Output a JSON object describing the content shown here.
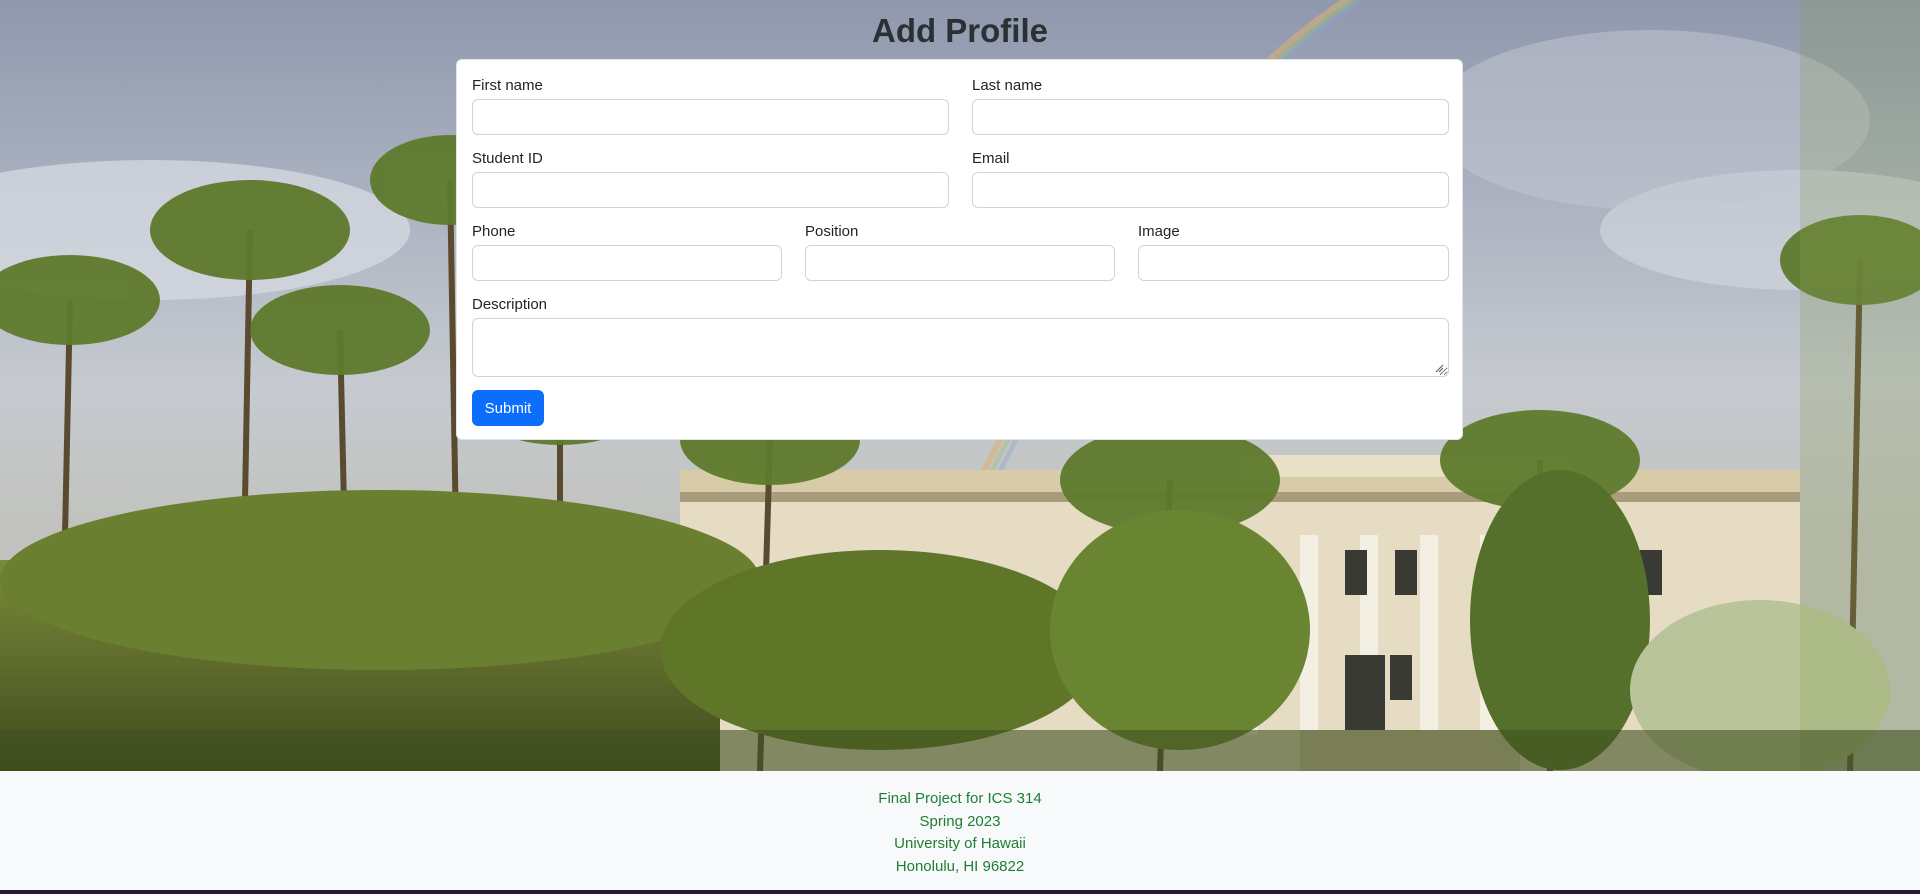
{
  "page": {
    "title": "Add Profile"
  },
  "form": {
    "first_name": {
      "label": "First name",
      "value": ""
    },
    "last_name": {
      "label": "Last name",
      "value": ""
    },
    "student_id": {
      "label": "Student ID",
      "value": ""
    },
    "email": {
      "label": "Email",
      "value": ""
    },
    "phone": {
      "label": "Phone",
      "value": ""
    },
    "position": {
      "label": "Position",
      "value": ""
    },
    "image": {
      "label": "Image",
      "value": ""
    },
    "description": {
      "label": "Description",
      "value": ""
    },
    "submit_label": "Submit"
  },
  "footer": {
    "line1": "Final Project for ICS 314",
    "line2": "Spring 2023",
    "line3": "University of Hawaii",
    "line4": "Honolulu, HI 96822"
  },
  "colors": {
    "primary": "#0d6efd",
    "footer_text": "#1e7e34",
    "footer_bg": "#f8f9fa"
  }
}
